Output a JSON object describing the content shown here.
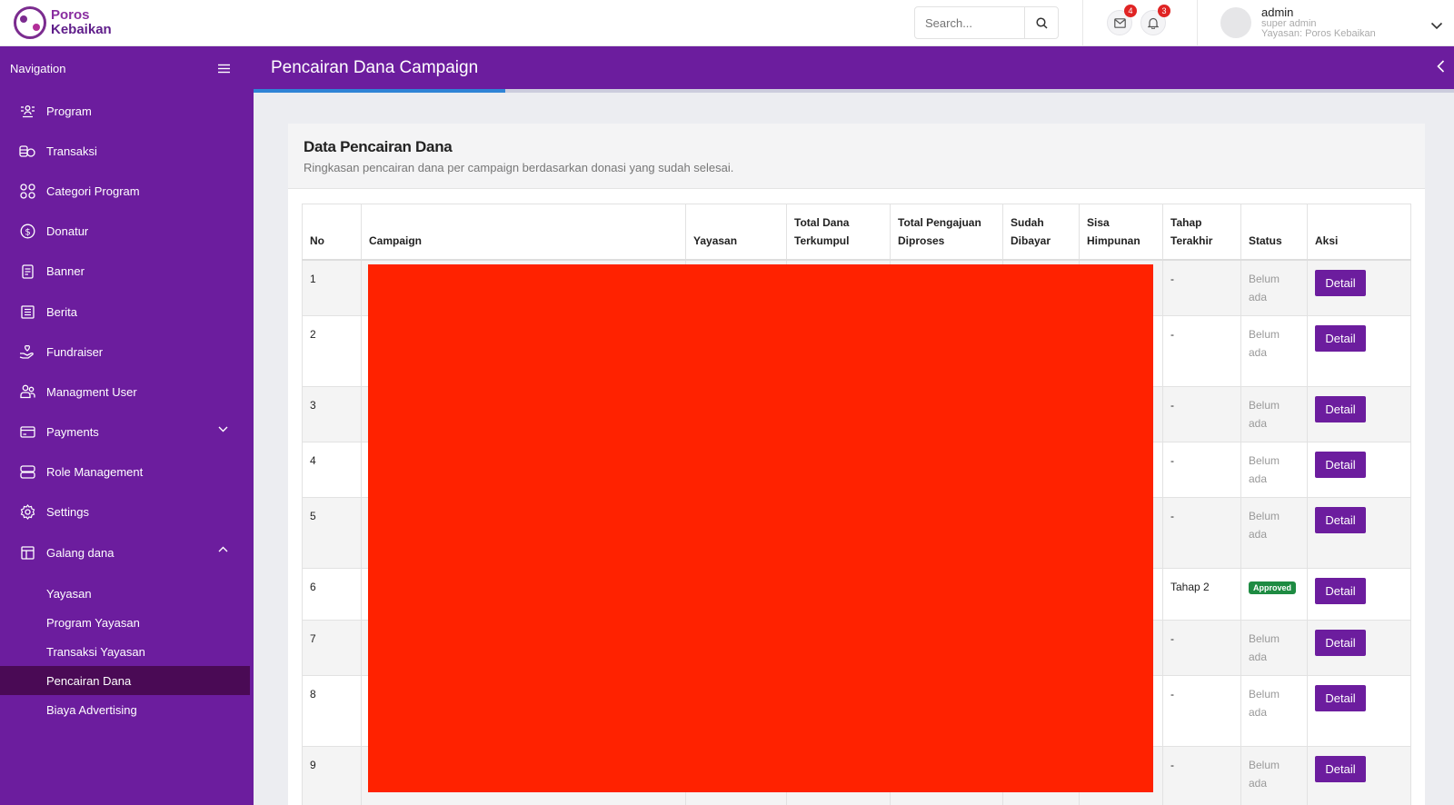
{
  "header": {
    "logo_line1": "Poros",
    "logo_line2": "Kebaikan",
    "search_placeholder": "Search...",
    "mail_count": "4",
    "notif_count": "3",
    "user_name": "admin",
    "user_role": "super admin",
    "user_org": "Yayasan: Poros Kebaikan"
  },
  "sidebar": {
    "title": "Navigation",
    "items": [
      {
        "label": "Program",
        "icon": "program-icon"
      },
      {
        "label": "Transaksi",
        "icon": "coins-icon"
      },
      {
        "label": "Categori Program",
        "icon": "grid-icon"
      },
      {
        "label": "Donatur",
        "icon": "dollar-circle-icon"
      },
      {
        "label": "Banner",
        "icon": "document-icon"
      },
      {
        "label": "Berita",
        "icon": "news-icon"
      },
      {
        "label": "Fundraiser",
        "icon": "hand-heart-icon"
      },
      {
        "label": "Managment User",
        "icon": "users-icon"
      },
      {
        "label": "Payments",
        "icon": "card-icon"
      },
      {
        "label": "Role Management",
        "icon": "server-icon"
      },
      {
        "label": "Settings",
        "icon": "gear-icon"
      },
      {
        "label": "Galang dana",
        "icon": "layout-icon"
      }
    ],
    "sub_items": [
      {
        "label": "Yayasan"
      },
      {
        "label": "Program Yayasan"
      },
      {
        "label": "Transaksi Yayasan"
      },
      {
        "label": "Pencairan Dana"
      },
      {
        "label": "Biaya Advertising"
      }
    ]
  },
  "page": {
    "title": "Pencairan Dana Campaign",
    "progress": 0.21
  },
  "card": {
    "title": "Data Pencairan Dana",
    "subtitle": "Ringkasan pencairan dana per campaign berdasarkan donasi yang sudah selesai."
  },
  "table": {
    "headers": {
      "no": "No",
      "campaign": "Campaign",
      "yayasan": "Yayasan",
      "total_dana_1": "Total Dana",
      "total_dana_2": "Terkumpul",
      "total_pengajuan_1": "Total Pengajuan",
      "total_pengajuan_2": "Diproses",
      "sudah_1": "Sudah",
      "sudah_2": "Dibayar",
      "sisa_1": "Sisa",
      "sisa_2": "Himpunan",
      "tahap_1": "Tahap",
      "tahap_2": "Terakhir",
      "status": "Status",
      "aksi": "Aksi"
    },
    "rows": [
      {
        "no": "1",
        "tahap": "-",
        "status_1": "Belum",
        "status_2": "ada",
        "action": "Detail"
      },
      {
        "no": "2",
        "tahap": "-",
        "status_1": "Belum",
        "status_2": "ada",
        "action": "Detail"
      },
      {
        "no": "3",
        "tahap": "-",
        "status_1": "Belum",
        "status_2": "ada",
        "action": "Detail"
      },
      {
        "no": "4",
        "tahap": "-",
        "status_1": "Belum",
        "status_2": "ada",
        "action": "Detail"
      },
      {
        "no": "5",
        "tahap": "-",
        "status_1": "Belum",
        "status_2": "ada",
        "action": "Detail"
      },
      {
        "no": "6",
        "tahap": "Tahap 2",
        "badge": "Approved",
        "action": "Detail"
      },
      {
        "no": "7",
        "tahap": "-",
        "status_1": "Belum",
        "status_2": "ada",
        "action": "Detail"
      },
      {
        "no": "8",
        "tahap": "-",
        "status_1": "Belum",
        "status_2": "ada",
        "action": "Detail"
      },
      {
        "no": "9",
        "tahap": "-",
        "status_1": "Belum",
        "status_2": "ada",
        "action": "Detail"
      }
    ]
  },
  "colors": {
    "primary": "#6c1d9e",
    "active_sub": "#4a0a55",
    "approved": "#1e8b42",
    "badge": "#e02424",
    "redaction": "#ff2200"
  }
}
